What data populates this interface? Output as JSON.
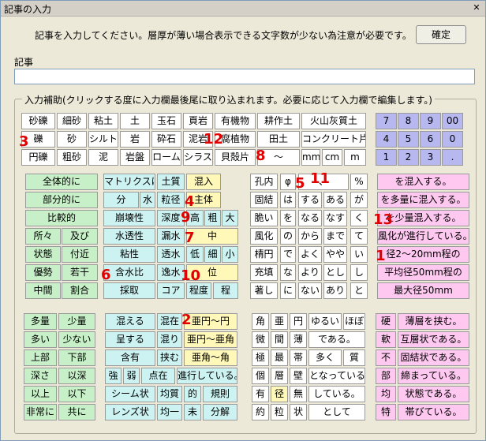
{
  "window": {
    "title": "記事の入力",
    "close_icon": "close-icon"
  },
  "message": "記事を入力してください。層厚が薄い場合表示できる文字数が少ない為注意が必要です。",
  "ok_button": "確定",
  "kiji": {
    "label": "記事",
    "value": ""
  },
  "assist_legend": "入力補助(クリックする度に入力欄最後尾に取り込まれます。必要に応じて入力欄で編集します。)",
  "soil_row1": [
    "砂礫",
    "細砂",
    "粘土",
    "土",
    "玉石",
    "頁岩",
    "有機物",
    "耕作土",
    "火山灰質土"
  ],
  "soil_row2": [
    "礫",
    "砂",
    "シルト",
    "岩",
    "砕石",
    "泥岩",
    "腐植物",
    "田土",
    "コンクリート片"
  ],
  "soil_row3": [
    "円礫",
    "粗砂",
    "泥",
    "岩盤",
    "ローム",
    "シラス",
    "貝殻片",
    "～",
    "mm",
    "cm",
    "m"
  ],
  "numpad": [
    "7",
    "8",
    "9",
    "00",
    "4",
    "5",
    "6",
    "0",
    "1",
    "2",
    "3",
    "."
  ],
  "mid_green": [
    "全体的に",
    "部分的に",
    "比較的",
    "所々",
    "及び",
    "状態",
    "付近",
    "優勢",
    "若干",
    "中間",
    "割合"
  ],
  "mid_col2": [
    "マトリクスは",
    "土質",
    "混入",
    "分",
    "水",
    "粒径",
    "主体",
    "崩壊性",
    "深度",
    "高",
    "粗",
    "大",
    "水透性",
    "漏水",
    "中",
    "粘性",
    "透水",
    "低",
    "細",
    "小",
    "含水比",
    "逸水",
    "位",
    "採取",
    "コア",
    "程度",
    "程"
  ],
  "mid_col3": [
    "孔内",
    "φ",
    "、",
    "%",
    "固結",
    "は",
    "する",
    "ある",
    "が",
    "脆い",
    "を",
    "なる",
    "なす",
    "く",
    "風化",
    "の",
    "から",
    "まで",
    "て",
    "棈円",
    "で",
    "よく",
    "やや",
    "い",
    "充填",
    "な",
    "より",
    "とし",
    "し",
    "著し",
    "に",
    "ない",
    "あり",
    "と"
  ],
  "mid_pink": [
    "を混入する。",
    "を多量に混入する。",
    "を少量混入する。",
    "風化が進行している。",
    "径2～20mm程の",
    "平均径50mm程の",
    "最大径50mm"
  ],
  "bot_green": [
    "多量",
    "少量",
    "多い",
    "少ない",
    "上部",
    "下部",
    "深さ",
    "以深",
    "以上",
    "以下",
    "非常に",
    "共に"
  ],
  "bot_col2": [
    "混える",
    "混在",
    "亜円～円",
    "呈する",
    "混り",
    "亜円～亜角",
    "含有",
    "挟む",
    "亜角～角",
    "強",
    "弱",
    "点在",
    "進行している。",
    "シーム状",
    "均質",
    "的",
    "規則",
    "レンズ状",
    "均一",
    "未",
    "分解"
  ],
  "bot_col3": [
    "角",
    "亜",
    "円",
    "ゆるい",
    "ほぼ",
    "微",
    "間",
    "薄",
    "である。",
    "極",
    "最",
    "帯",
    "多く",
    "質",
    "個",
    "層",
    "壁",
    "となっている。",
    "有",
    "径",
    "無",
    "している。",
    "約",
    "粒",
    "状",
    "として"
  ],
  "bot_pink": [
    "硬",
    "薄層を挟む。",
    "軟",
    "互層状である。",
    "不",
    "固結状である。",
    "部",
    "締まっている。",
    "均",
    "状態である。",
    "特",
    "帯びている。"
  ],
  "annotations": [
    "1",
    "2",
    "3",
    "4",
    "5",
    "6",
    "7",
    "8",
    "9",
    "10",
    "11",
    "12",
    "13"
  ],
  "colors": {
    "white": "#ffffff",
    "green": "#c8f0c8",
    "cyan": "#ccf2f2",
    "yellow": "#fff8b8",
    "pink": "#ffc8f0",
    "blue": "#b8b8f0",
    "annotation": "#e00000"
  }
}
